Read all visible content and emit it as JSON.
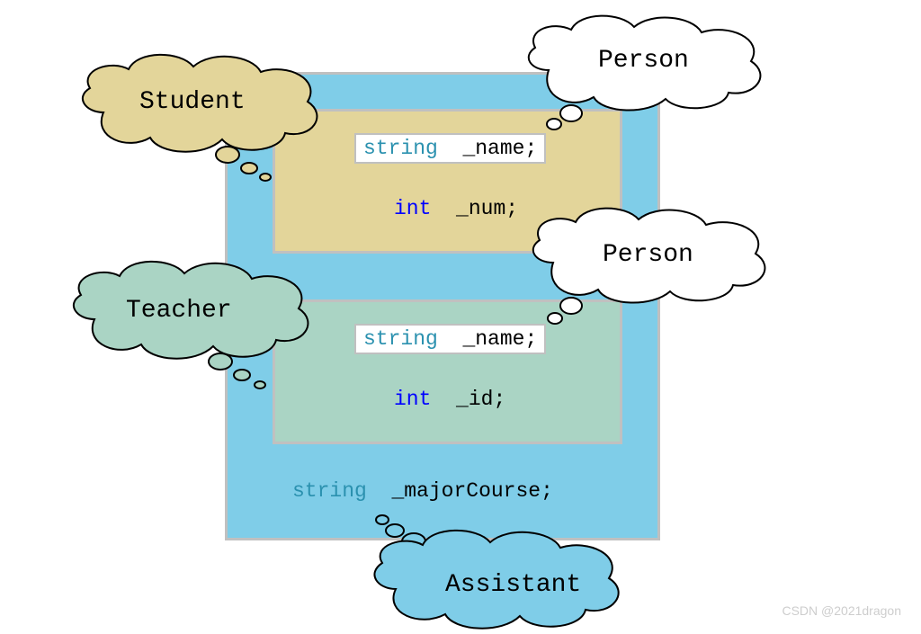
{
  "diagram": {
    "outer_label_type": "string",
    "outer_label_name": "_majorCourse;",
    "box1": {
      "field1_type": "string",
      "field1_name": "_name;",
      "field2_type": "int",
      "field2_name": "_num;"
    },
    "box2": {
      "field1_type": "string",
      "field1_name": "_name;",
      "field2_type": "int",
      "field2_name": "_id;"
    }
  },
  "bubbles": {
    "student": "Student",
    "teacher": "Teacher",
    "person1": "Person",
    "person2": "Person",
    "assistant": "Assistant"
  },
  "watermark": "CSDN @2021dragon"
}
